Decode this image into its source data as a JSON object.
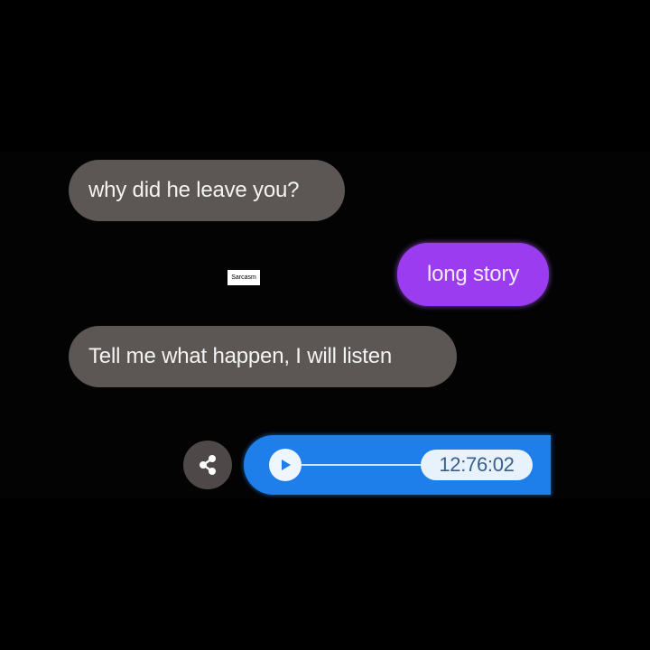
{
  "messages": [
    {
      "side": "incoming",
      "text": "why did he leave you?"
    },
    {
      "side": "outgoing",
      "text": "long story"
    },
    {
      "side": "incoming",
      "text": "Tell me what happen, I will listen"
    }
  ],
  "watermark": {
    "text": "Sarcasm"
  },
  "voice_message": {
    "duration": "12:76:02",
    "share_icon": "share-icon",
    "play_icon": "play-icon"
  },
  "colors": {
    "background": "#000000",
    "incoming_bubble": "#5c5655",
    "outgoing_bubble": "#9b3cf0",
    "voice_bubble": "#1f7fea"
  }
}
